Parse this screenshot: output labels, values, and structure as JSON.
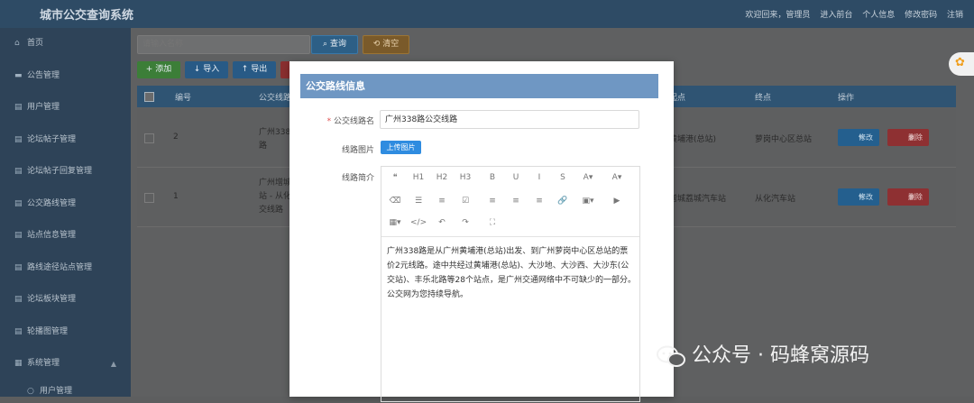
{
  "app": {
    "title": "城市公交查询系统",
    "top_links": [
      "欢迎回来，管理员",
      "进入前台",
      "个人信息",
      "修改密码",
      "注销"
    ]
  },
  "sidebar": {
    "items": [
      {
        "icon": "home-icon",
        "glyph": "⌂",
        "label": "首页"
      },
      {
        "icon": "notice-icon",
        "glyph": "▬",
        "label": "公告管理"
      },
      {
        "icon": "grid-icon",
        "glyph": "▤",
        "label": "用户管理"
      },
      {
        "icon": "grid-icon",
        "glyph": "▤",
        "label": "论坛帖子管理"
      },
      {
        "icon": "grid-icon",
        "glyph": "▤",
        "label": "论坛帖子回复管理"
      },
      {
        "icon": "grid-icon",
        "glyph": "▤",
        "label": "公交路线管理"
      },
      {
        "icon": "grid-icon",
        "glyph": "▤",
        "label": "站点信息管理"
      },
      {
        "icon": "grid-icon",
        "glyph": "▤",
        "label": "路线途径站点管理"
      },
      {
        "icon": "grid-icon",
        "glyph": "▤",
        "label": "论坛板块管理"
      },
      {
        "icon": "grid-icon",
        "glyph": "▤",
        "label": "轮播图管理"
      },
      {
        "icon": "apps-icon",
        "glyph": "▦",
        "label": "系统管理"
      }
    ],
    "sub_items": [
      {
        "icon": "user-icon",
        "glyph": "○",
        "label": "用户管理"
      }
    ]
  },
  "search": {
    "placeholder": "请输入名称",
    "query_label": "查询",
    "reset_label": "清空"
  },
  "toolbar": {
    "add_label": "添加",
    "import_label": "导入",
    "export_label": "导出"
  },
  "table": {
    "headers": [
      "编号",
      "公交线路",
      "起点",
      "终点",
      "操作"
    ],
    "rows": [
      {
        "id": "2",
        "route": [
          "广州338",
          "路"
        ],
        "start": "黄埔港(总站)",
        "end": "萝岗中心区总站"
      },
      {
        "id": "1",
        "route": [
          "广州增城",
          "站 - 从化",
          "交线路"
        ],
        "start": "增城荔城汽车站",
        "end": "从化汽车站"
      }
    ],
    "edit_label": "修改",
    "delete_label": "删除"
  },
  "modal": {
    "title": "公交路线信息",
    "name_label": "公交线路名",
    "name_value": "广州338路公交线路",
    "image_label": "线路图片",
    "upload_label": "上传图片",
    "intro_label": "线路简介",
    "content": "广州338路是从广州黄埔港(总站)出发、到广州萝岗中心区总站的票价2元线路。途中共经过黄埔港(总站)、大沙地、大沙西、大沙东(公交站)、丰乐北路等28个站点，是广州交通网络中不可缺少的一部分。公交网为您持续导航。"
  },
  "editor_tools": [
    {
      "name": "blockquote-icon",
      "glyph": "❝"
    },
    {
      "name": "h1-button",
      "glyph": "H1"
    },
    {
      "name": "h2-button",
      "glyph": "H2"
    },
    {
      "name": "h3-button",
      "glyph": "H3"
    },
    {
      "name": "bold-icon",
      "glyph": "B"
    },
    {
      "name": "underline-icon",
      "glyph": "U"
    },
    {
      "name": "italic-icon",
      "glyph": "I"
    },
    {
      "name": "strike-icon",
      "glyph": "S"
    },
    {
      "name": "font-color-icon",
      "glyph": "A▾"
    },
    {
      "name": "bg-color-icon",
      "glyph": "A▾"
    },
    {
      "name": "clean-icon",
      "glyph": "⌫"
    },
    {
      "name": "list-ul-icon",
      "glyph": "☰"
    },
    {
      "name": "list-ol-icon",
      "glyph": "≡"
    },
    {
      "name": "check-icon",
      "glyph": "☑"
    },
    {
      "name": "align-left-icon",
      "glyph": "≡"
    },
    {
      "name": "align-center-icon",
      "glyph": "≡"
    },
    {
      "name": "align-right-icon",
      "glyph": "≡"
    },
    {
      "name": "link-icon",
      "glyph": "🔗"
    },
    {
      "name": "image-icon",
      "glyph": "▣▾"
    },
    {
      "name": "video-icon",
      "glyph": "▶"
    },
    {
      "name": "table-icon",
      "glyph": "▦▾"
    },
    {
      "name": "code-icon",
      "glyph": "</>"
    },
    {
      "name": "undo-icon",
      "glyph": "↶"
    },
    {
      "name": "redo-icon",
      "glyph": "↷"
    },
    {
      "name": "fullscreen-icon",
      "glyph": "⛶"
    }
  ],
  "watermark": {
    "text": "公众号 · 码蜂窝源码"
  },
  "colors": {
    "topbar": "#2e4b65",
    "sidebar": "#2e4358",
    "modal_header": "#6f97c3",
    "upload": "#2f8ce0"
  }
}
